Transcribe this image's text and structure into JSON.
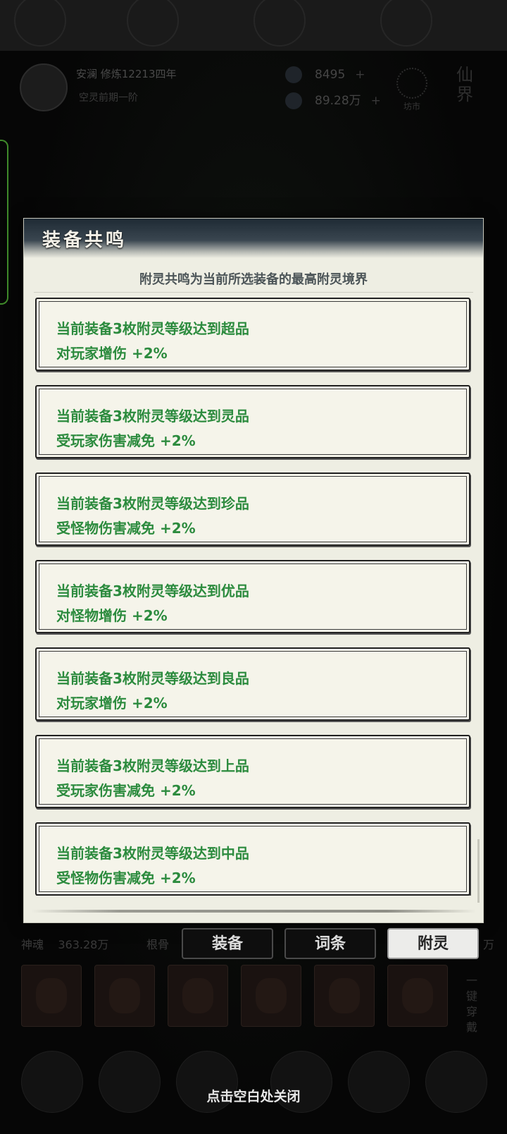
{
  "background": {
    "player_name": "安澜  修炼12213四年",
    "player_realm": "空灵前期一阶",
    "resource_1": "8495",
    "resource_2": "89.28万",
    "plus": "+",
    "market_label": "坊市",
    "immortal_label": "仙界",
    "stat_soul_label": "神魂",
    "stat_soul_value": "363.28万",
    "stat_extra": "根骨",
    "stat_right": "万",
    "slot_extra": "一键穿戴"
  },
  "modal": {
    "title": "装备共鸣",
    "subtitle": "附灵共鸣为当前所选装备的最高附灵境界",
    "effects": [
      {
        "requirement": "当前装备3枚附灵等级达到超品",
        "bonus": "对玩家增伤  +2%"
      },
      {
        "requirement": "当前装备3枚附灵等级达到灵品",
        "bonus": "受玩家伤害减免  +2%"
      },
      {
        "requirement": "当前装备3枚附灵等级达到珍品",
        "bonus": "受怪物伤害减免  +2%"
      },
      {
        "requirement": "当前装备3枚附灵等级达到优品",
        "bonus": "对怪物增伤  +2%"
      },
      {
        "requirement": "当前装备3枚附灵等级达到良品",
        "bonus": "对玩家增伤  +2%"
      },
      {
        "requirement": "当前装备3枚附灵等级达到上品",
        "bonus": "受玩家伤害减免  +2%"
      },
      {
        "requirement": "当前装备3枚附灵等级达到中品",
        "bonus": "受怪物伤害减免  +2%"
      }
    ]
  },
  "tabs": [
    {
      "label": "装备",
      "active": false
    },
    {
      "label": "词条",
      "active": false
    },
    {
      "label": "附灵",
      "active": true
    }
  ],
  "close_hint": "点击空白处关闭",
  "colors": {
    "effect_text": "#2c8b3e",
    "modal_bg": "#eeeee3",
    "header_dark": "#1e2a34",
    "active_tab_bg": "#ececea"
  }
}
